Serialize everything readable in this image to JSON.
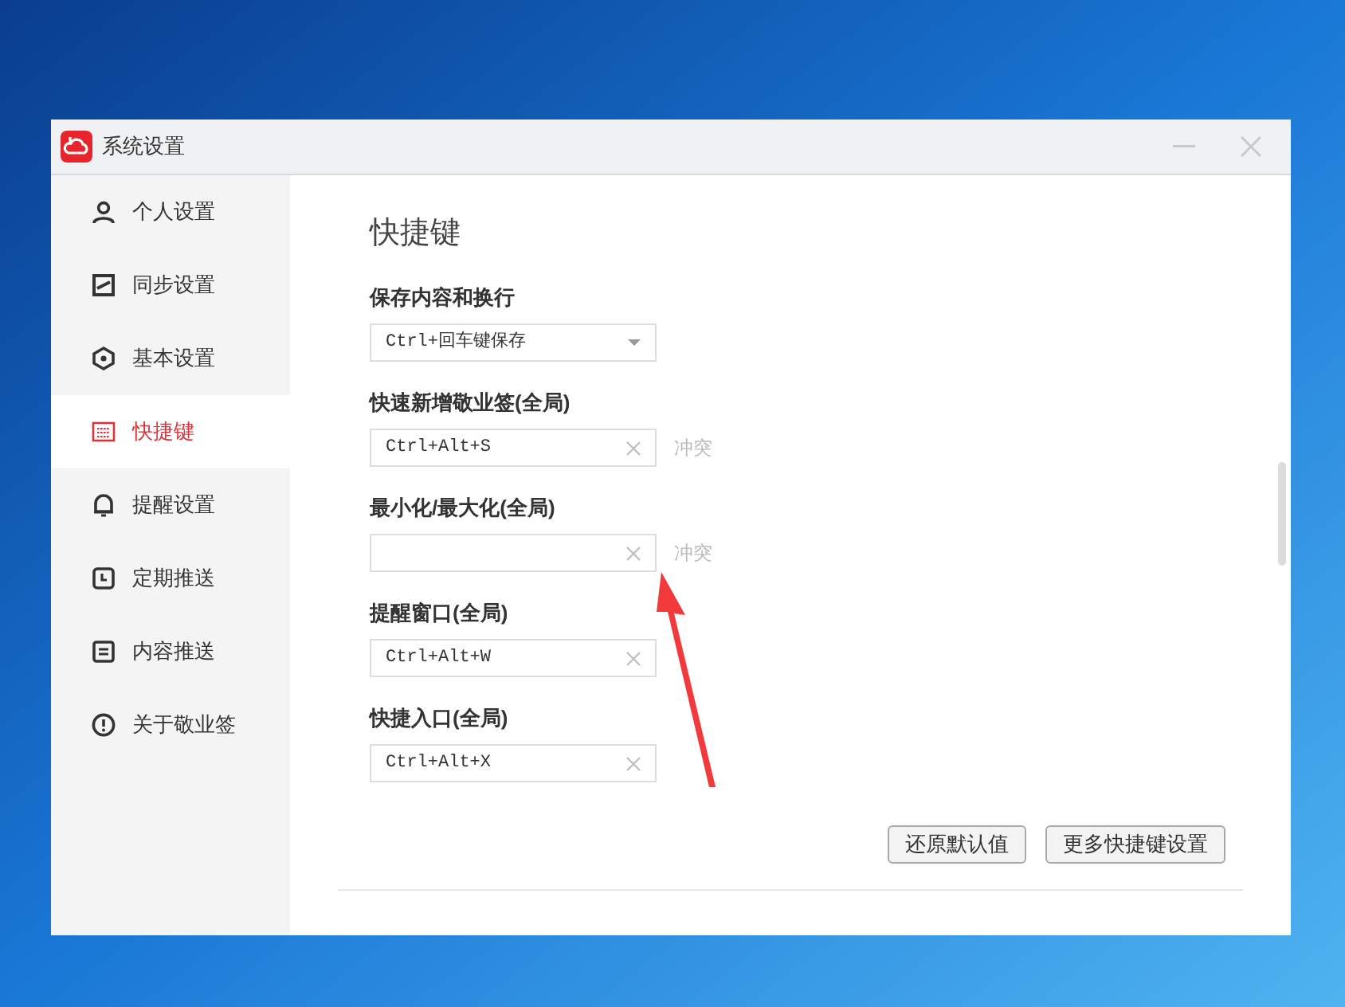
{
  "window": {
    "title": "系统设置"
  },
  "sidebar": {
    "items": [
      {
        "label": "个人设置",
        "selected": false
      },
      {
        "label": "同步设置",
        "selected": false
      },
      {
        "label": "基本设置",
        "selected": false
      },
      {
        "label": "快捷键",
        "selected": true
      },
      {
        "label": "提醒设置",
        "selected": false
      },
      {
        "label": "定期推送",
        "selected": false
      },
      {
        "label": "内容推送",
        "selected": false
      },
      {
        "label": "关于敬业签",
        "selected": false
      }
    ]
  },
  "heading": "快捷键",
  "shortcuts": [
    {
      "label": "保存内容和换行",
      "kind": "dropdown",
      "value": "Ctrl+回车键保存"
    },
    {
      "label": "快速新增敬业签(全局)",
      "kind": "input",
      "value": "Ctrl+Alt+S",
      "conflict": "冲突"
    },
    {
      "label": "最小化/最大化(全局)",
      "kind": "input",
      "conflict": "冲突"
    },
    {
      "label": "提醒窗口(全局)",
      "kind": "input",
      "value": "Ctrl+Alt+W"
    },
    {
      "label": "快捷入口(全局)",
      "kind": "input",
      "value": "Ctrl+Alt+X"
    }
  ],
  "buttons": [
    "还原默认值",
    "更多快捷键设置"
  ]
}
